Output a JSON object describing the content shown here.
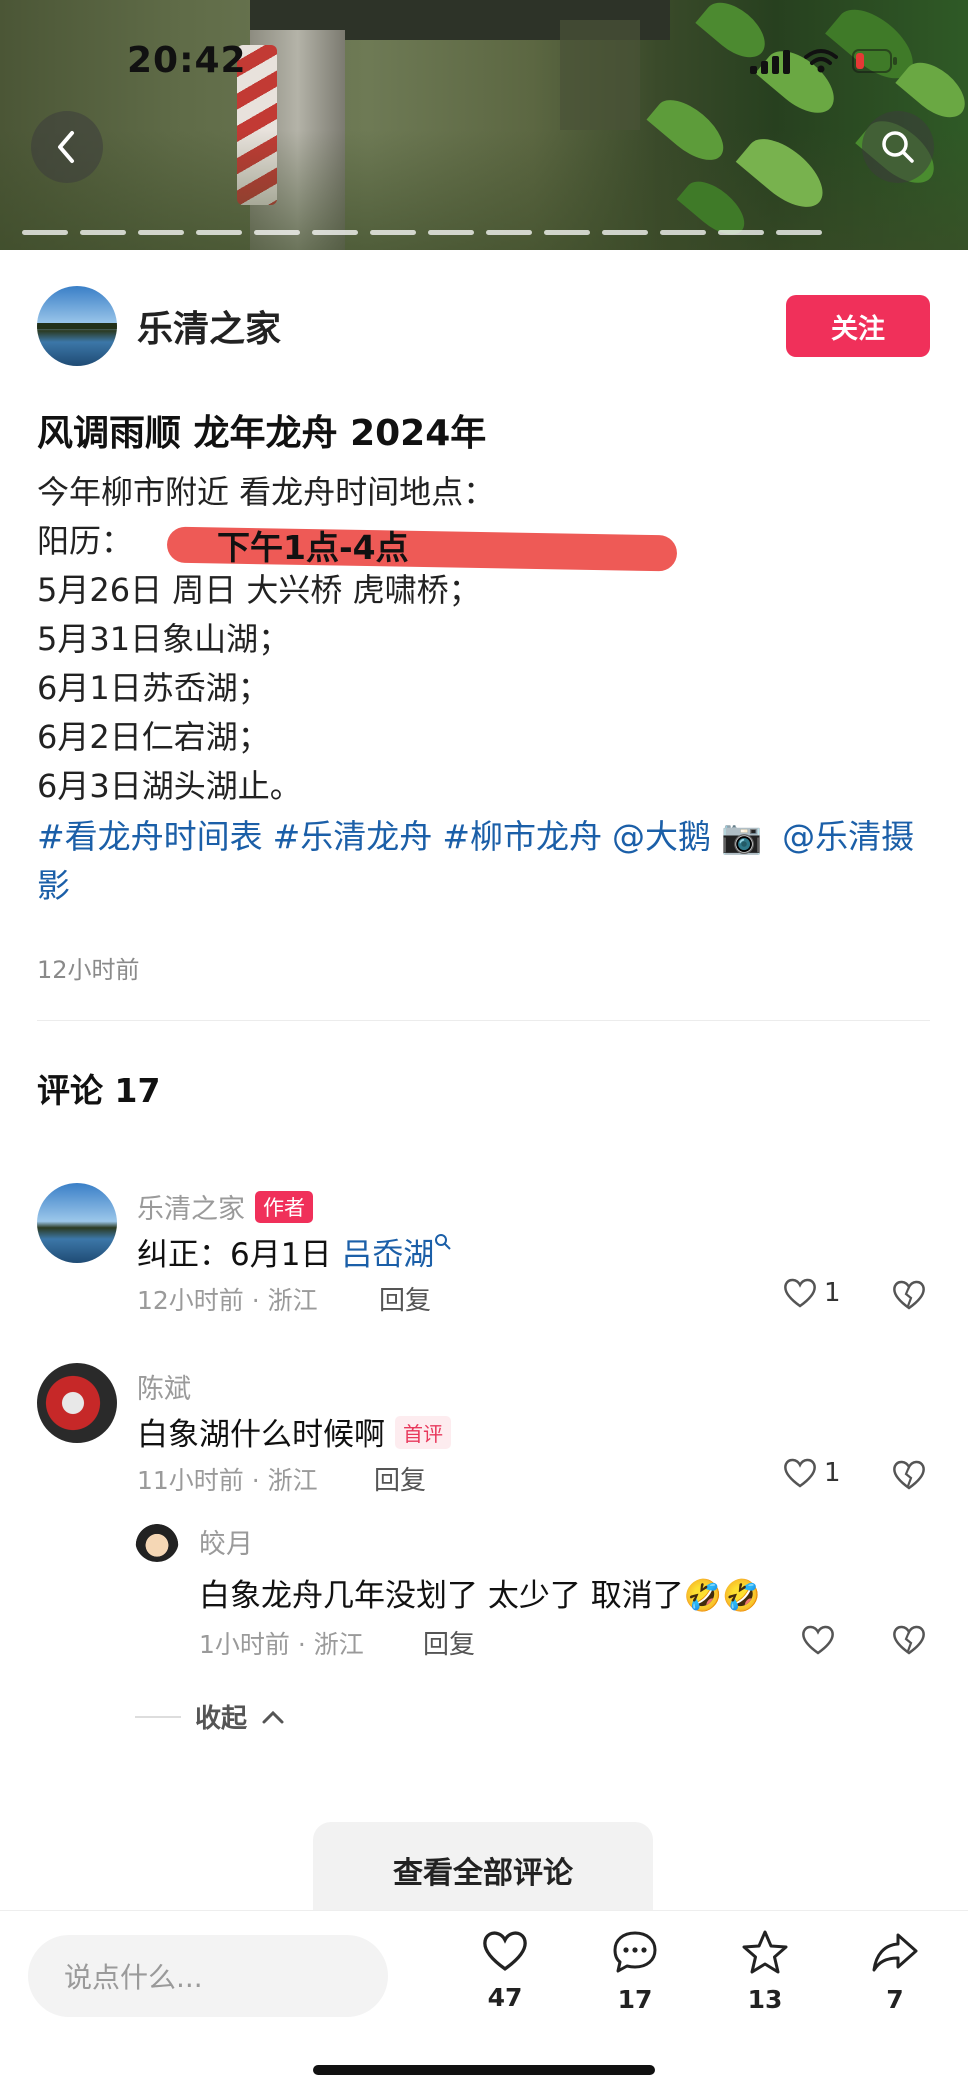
{
  "status_bar": {
    "time": "20:42"
  },
  "header": {
    "back_icon": "chevron-left-icon",
    "search_icon": "search-icon"
  },
  "author": {
    "name": "乐清之家",
    "follow_label": "关注"
  },
  "post": {
    "title": "风调雨顺 龙年龙舟 2024年",
    "lines": [
      "今年柳市附近 看龙舟时间地点：",
      "阳历：",
      "5月26日 周日 大兴桥 虎啸桥；",
      "5月31日象山湖；",
      "6月1日苏岙湖；",
      "6月2日仁宕湖；",
      "6月3日湖头湖止。"
    ],
    "annotation": "下午1点-4点",
    "tags": [
      "#看龙舟时间表",
      "#乐清龙舟",
      "#柳市龙舟"
    ],
    "mentions": [
      "@大鹅",
      "@乐清摄影"
    ],
    "time_ago": "12小时前"
  },
  "comments": {
    "header": "评论 17",
    "items": [
      {
        "name": "乐清之家",
        "badge": "作者",
        "text_prefix": "纠正：6月1日 ",
        "text_link": "吕岙湖",
        "meta": "12小时前 · 浙江",
        "reply": "回复",
        "likes": "1"
      },
      {
        "name": "陈斌",
        "badge": "首评",
        "text": "白象湖什么时候啊",
        "meta": "11小时前 · 浙江",
        "reply": "回复",
        "likes": "1"
      },
      {
        "name": "皎月",
        "text": "白象龙舟几年没划了 太少了 取消了",
        "emoji": "🤣🤣",
        "meta": "1小时前 · 浙江",
        "reply": "回复"
      }
    ],
    "collapse_label": "收起",
    "view_all_label": "查看全部评论"
  },
  "bottom_bar": {
    "input_placeholder": "说点什么...",
    "likes": "47",
    "comments": "17",
    "stars": "13",
    "shares": "7"
  },
  "colors": {
    "accent": "#f0305a",
    "link": "#1b5fa8"
  }
}
